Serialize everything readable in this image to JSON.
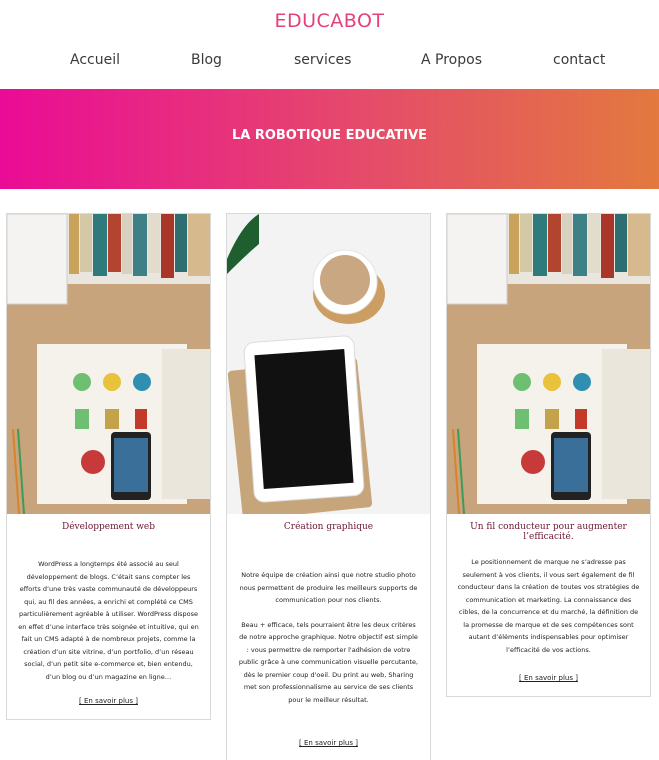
{
  "brand": "EDUCABOT",
  "nav": [
    "Accueil",
    "Blog",
    "services",
    "A Propos",
    "contact"
  ],
  "hero": {
    "title": "LA ROBOTIQUE EDUCATIVE",
    "gradient": [
      "#ea0b96",
      "#e3793e"
    ]
  },
  "cards": [
    {
      "image": "desk-books-phone-logos-photo",
      "title": "Développement web",
      "paragraphs": [
        "WordPress a longtemps été associé au seul développement de blogs. C’était sans compter les efforts d’une très vaste communauté de développeurs qui, au fil des années, a enrichi et complété ce CMS particulièrement agréable à utiliser. WordPress dispose en effet d’une interface très soignée et intuitive, qui en fait un CMS adapté à de nombreux projets, comme la création d’un site vitrine, d’un portfolio, d’un réseau social, d’un petit site e-commerce et, bien entendu, d’un blog ou d’un magazine en ligne…"
      ],
      "more": "[ En savoir plus ]"
    },
    {
      "image": "tablet-coffee-plant-photo",
      "title": "Création graphique",
      "paragraphs": [
        "Notre équipe de création ainsi que notre studio photo nous permettent de produire les meilleurs supports de communication pour nos clients.",
        "Beau + efficace, tels pourraient être les deux critères de notre approche graphique. Notre objectif est simple : vous permettre de remporter l'adhésion de votre public grâce à une communication visuelle percutante, dès le premier coup d'oeil. Du print au web, Sharing met son professionnalisme au service de ses clients pour le meilleur résultat."
      ],
      "more": "[ En savoir plus ]"
    },
    {
      "image": "desk-books-phone-logos-photo",
      "title": "Un fil conducteur pour augmenter l’efficacité.",
      "paragraphs": [
        "Le positionnement de marque ne s’adresse pas seulement à vos clients, il vous sert également de fil conducteur dans la création de toutes vos stratégies de communication et marketing. La connaissance des cibles, de la concurrence et du marché, la définition de la promesse de marque et de ses compétences sont autant d’éléments indispensables pour optimiser l’efficacité de vos actions."
      ],
      "more": "[ En savoir plus ]"
    }
  ],
  "colors": {
    "brand": "#e5407b",
    "card_title": "#6d1733"
  }
}
